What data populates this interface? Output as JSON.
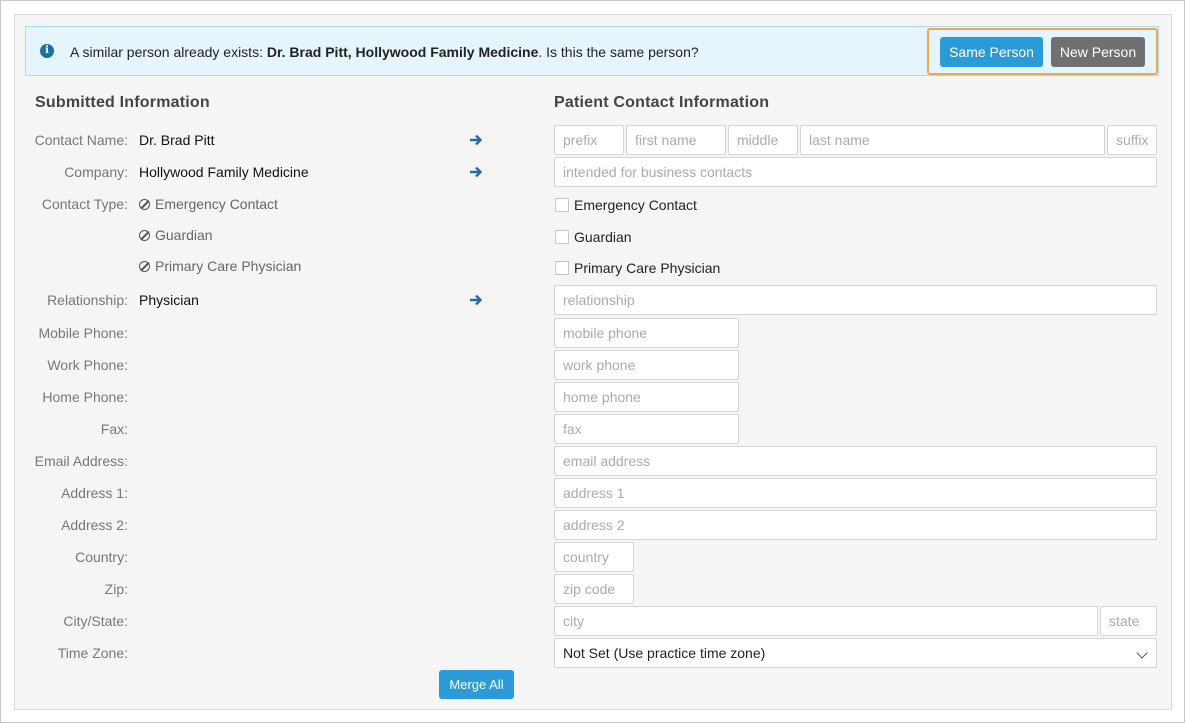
{
  "alert": {
    "prefix": "A similar person already exists: ",
    "match": "Dr. Brad Pitt, Hollywood Family Medicine",
    "suffix": ". Is this the same person?",
    "same_person_label": "Same Person",
    "new_person_label": "New Person"
  },
  "left": {
    "title": "Submitted Information",
    "contact_name": {
      "label": "Contact Name:",
      "value": "Dr. Brad Pitt"
    },
    "company": {
      "label": "Company:",
      "value": "Hollywood Family Medicine"
    },
    "contact_type": {
      "label": "Contact Type:",
      "items": [
        "Emergency Contact",
        "Guardian",
        "Primary Care Physician"
      ]
    },
    "relationship": {
      "label": "Relationship:",
      "value": "Physician"
    },
    "labels": {
      "mobile": "Mobile Phone:",
      "work": "Work Phone:",
      "home": "Home Phone:",
      "fax": "Fax:",
      "email": "Email Address:",
      "address1": "Address 1:",
      "address2": "Address 2:",
      "country": "Country:",
      "zip": "Zip:",
      "citystate": "City/State:",
      "timezone": "Time Zone:"
    },
    "merge_all": "Merge All"
  },
  "right": {
    "title": "Patient Contact Information",
    "placeholders": {
      "prefix": "prefix",
      "first": "first name",
      "middle": "middle",
      "last": "last name",
      "suffix": "suffix",
      "company": "intended for business contacts",
      "relationship": "relationship",
      "mobile": "mobile phone",
      "work": "work phone",
      "home": "home phone",
      "fax": "fax",
      "email": "email address",
      "address1": "address 1",
      "address2": "address 2",
      "country": "country",
      "zip": "zip code",
      "city": "city",
      "state": "state"
    },
    "checkboxes": [
      "Emergency Contact",
      "Guardian",
      "Primary Care Physician"
    ],
    "timezone_value": "Not Set (Use practice time zone)"
  },
  "colors": {
    "accent": "#2b9ad9",
    "alert_bg": "#e6f5fb",
    "highlight": "#f0a850",
    "arrow": "#1d6fa5"
  }
}
